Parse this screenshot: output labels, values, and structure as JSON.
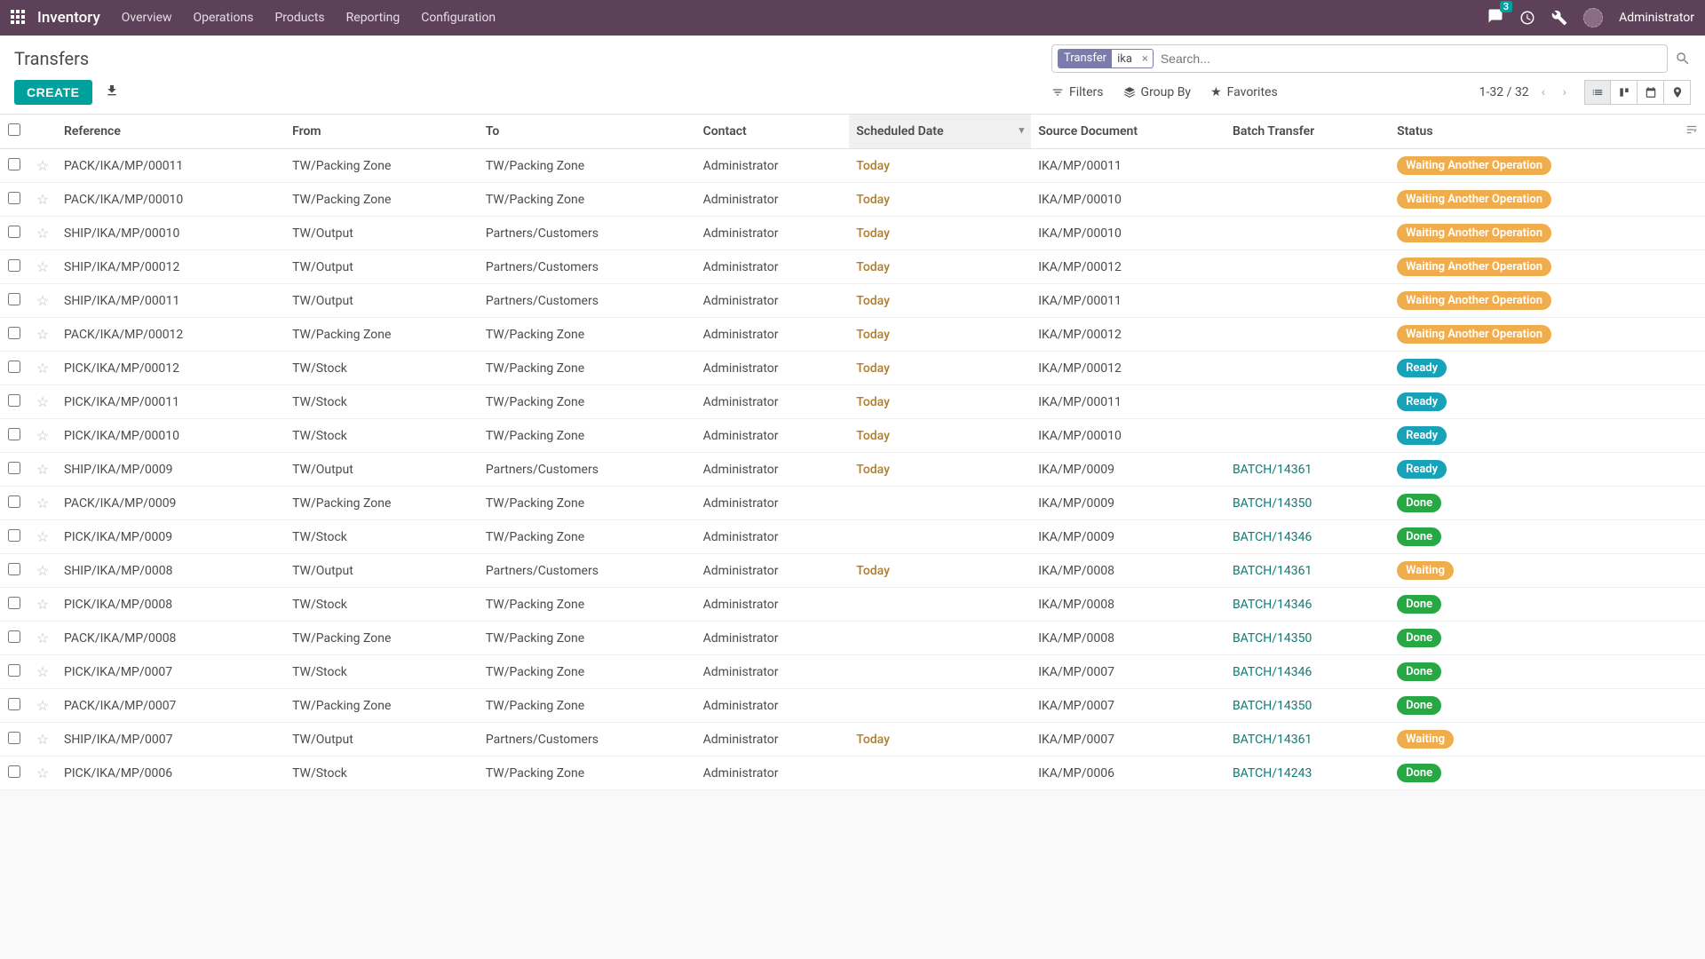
{
  "nav": {
    "brand": "Inventory",
    "items": [
      "Overview",
      "Operations",
      "Products",
      "Reporting",
      "Configuration"
    ],
    "messages_count": "3",
    "user": "Administrator"
  },
  "breadcrumb": "Transfers",
  "search": {
    "facet_label": "Transfer",
    "facet_value": "ika",
    "placeholder": "Search..."
  },
  "buttons": {
    "create": "CREATE",
    "filters": "Filters",
    "groupby": "Group By",
    "favorites": "Favorites"
  },
  "pager": {
    "text": "1-32 / 32"
  },
  "columns": {
    "reference": "Reference",
    "from": "From",
    "to": "To",
    "contact": "Contact",
    "scheduled": "Scheduled Date",
    "source": "Source Document",
    "batch": "Batch Transfer",
    "status": "Status"
  },
  "status_labels": {
    "waiting_op": "Waiting Another Operation",
    "ready": "Ready",
    "done": "Done",
    "waiting": "Waiting"
  },
  "rows": [
    {
      "ref": "PACK/IKA/MP/00011",
      "from": "TW/Packing Zone",
      "to": "TW/Packing Zone",
      "contact": "Administrator",
      "scheduled": "Today",
      "source": "IKA/MP/00011",
      "batch": "",
      "status": "waiting_op"
    },
    {
      "ref": "PACK/IKA/MP/00010",
      "from": "TW/Packing Zone",
      "to": "TW/Packing Zone",
      "contact": "Administrator",
      "scheduled": "Today",
      "source": "IKA/MP/00010",
      "batch": "",
      "status": "waiting_op"
    },
    {
      "ref": "SHIP/IKA/MP/00010",
      "from": "TW/Output",
      "to": "Partners/Customers",
      "contact": "Administrator",
      "scheduled": "Today",
      "source": "IKA/MP/00010",
      "batch": "",
      "status": "waiting_op"
    },
    {
      "ref": "SHIP/IKA/MP/00012",
      "from": "TW/Output",
      "to": "Partners/Customers",
      "contact": "Administrator",
      "scheduled": "Today",
      "source": "IKA/MP/00012",
      "batch": "",
      "status": "waiting_op"
    },
    {
      "ref": "SHIP/IKA/MP/00011",
      "from": "TW/Output",
      "to": "Partners/Customers",
      "contact": "Administrator",
      "scheduled": "Today",
      "source": "IKA/MP/00011",
      "batch": "",
      "status": "waiting_op"
    },
    {
      "ref": "PACK/IKA/MP/00012",
      "from": "TW/Packing Zone",
      "to": "TW/Packing Zone",
      "contact": "Administrator",
      "scheduled": "Today",
      "source": "IKA/MP/00012",
      "batch": "",
      "status": "waiting_op"
    },
    {
      "ref": "PICK/IKA/MP/00012",
      "from": "TW/Stock",
      "to": "TW/Packing Zone",
      "contact": "Administrator",
      "scheduled": "Today",
      "source": "IKA/MP/00012",
      "batch": "",
      "status": "ready"
    },
    {
      "ref": "PICK/IKA/MP/00011",
      "from": "TW/Stock",
      "to": "TW/Packing Zone",
      "contact": "Administrator",
      "scheduled": "Today",
      "source": "IKA/MP/00011",
      "batch": "",
      "status": "ready"
    },
    {
      "ref": "PICK/IKA/MP/00010",
      "from": "TW/Stock",
      "to": "TW/Packing Zone",
      "contact": "Administrator",
      "scheduled": "Today",
      "source": "IKA/MP/00010",
      "batch": "",
      "status": "ready"
    },
    {
      "ref": "SHIP/IKA/MP/0009",
      "from": "TW/Output",
      "to": "Partners/Customers",
      "contact": "Administrator",
      "scheduled": "Today",
      "source": "IKA/MP/0009",
      "batch": "BATCH/14361",
      "status": "ready"
    },
    {
      "ref": "PACK/IKA/MP/0009",
      "from": "TW/Packing Zone",
      "to": "TW/Packing Zone",
      "contact": "Administrator",
      "scheduled": "",
      "source": "IKA/MP/0009",
      "batch": "BATCH/14350",
      "status": "done"
    },
    {
      "ref": "PICK/IKA/MP/0009",
      "from": "TW/Stock",
      "to": "TW/Packing Zone",
      "contact": "Administrator",
      "scheduled": "",
      "source": "IKA/MP/0009",
      "batch": "BATCH/14346",
      "status": "done"
    },
    {
      "ref": "SHIP/IKA/MP/0008",
      "from": "TW/Output",
      "to": "Partners/Customers",
      "contact": "Administrator",
      "scheduled": "Today",
      "source": "IKA/MP/0008",
      "batch": "BATCH/14361",
      "status": "waiting"
    },
    {
      "ref": "PICK/IKA/MP/0008",
      "from": "TW/Stock",
      "to": "TW/Packing Zone",
      "contact": "Administrator",
      "scheduled": "",
      "source": "IKA/MP/0008",
      "batch": "BATCH/14346",
      "status": "done"
    },
    {
      "ref": "PACK/IKA/MP/0008",
      "from": "TW/Packing Zone",
      "to": "TW/Packing Zone",
      "contact": "Administrator",
      "scheduled": "",
      "source": "IKA/MP/0008",
      "batch": "BATCH/14350",
      "status": "done"
    },
    {
      "ref": "PICK/IKA/MP/0007",
      "from": "TW/Stock",
      "to": "TW/Packing Zone",
      "contact": "Administrator",
      "scheduled": "",
      "source": "IKA/MP/0007",
      "batch": "BATCH/14346",
      "status": "done"
    },
    {
      "ref": "PACK/IKA/MP/0007",
      "from": "TW/Packing Zone",
      "to": "TW/Packing Zone",
      "contact": "Administrator",
      "scheduled": "",
      "source": "IKA/MP/0007",
      "batch": "BATCH/14350",
      "status": "done"
    },
    {
      "ref": "SHIP/IKA/MP/0007",
      "from": "TW/Output",
      "to": "Partners/Customers",
      "contact": "Administrator",
      "scheduled": "Today",
      "source": "IKA/MP/0007",
      "batch": "BATCH/14361",
      "status": "waiting"
    },
    {
      "ref": "PICK/IKA/MP/0006",
      "from": "TW/Stock",
      "to": "TW/Packing Zone",
      "contact": "Administrator",
      "scheduled": "",
      "source": "IKA/MP/0006",
      "batch": "BATCH/14243",
      "status": "done"
    }
  ]
}
